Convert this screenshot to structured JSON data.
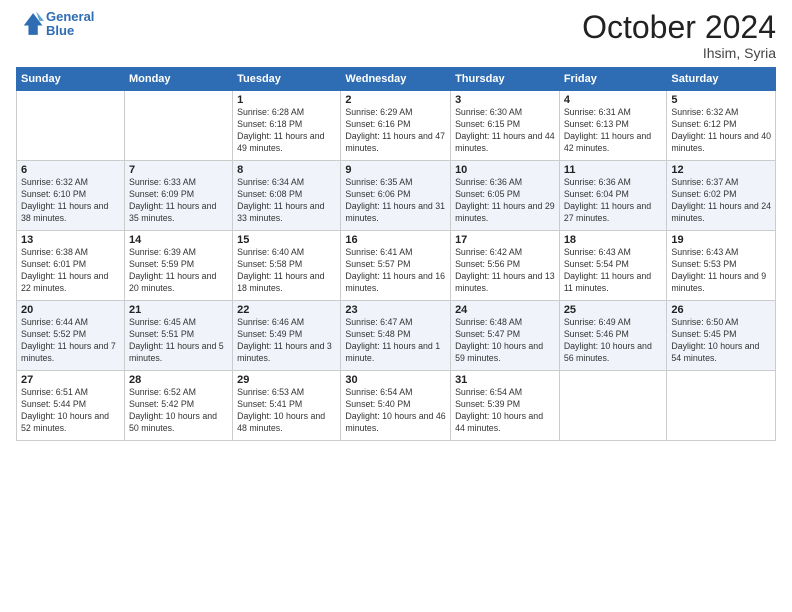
{
  "header": {
    "logo_line1": "General",
    "logo_line2": "Blue",
    "month": "October 2024",
    "location": "Ihsim, Syria"
  },
  "days_of_week": [
    "Sunday",
    "Monday",
    "Tuesday",
    "Wednesday",
    "Thursday",
    "Friday",
    "Saturday"
  ],
  "weeks": [
    [
      {
        "day": "",
        "info": ""
      },
      {
        "day": "",
        "info": ""
      },
      {
        "day": "1",
        "info": "Sunrise: 6:28 AM\nSunset: 6:18 PM\nDaylight: 11 hours and 49 minutes."
      },
      {
        "day": "2",
        "info": "Sunrise: 6:29 AM\nSunset: 6:16 PM\nDaylight: 11 hours and 47 minutes."
      },
      {
        "day": "3",
        "info": "Sunrise: 6:30 AM\nSunset: 6:15 PM\nDaylight: 11 hours and 44 minutes."
      },
      {
        "day": "4",
        "info": "Sunrise: 6:31 AM\nSunset: 6:13 PM\nDaylight: 11 hours and 42 minutes."
      },
      {
        "day": "5",
        "info": "Sunrise: 6:32 AM\nSunset: 6:12 PM\nDaylight: 11 hours and 40 minutes."
      }
    ],
    [
      {
        "day": "6",
        "info": "Sunrise: 6:32 AM\nSunset: 6:10 PM\nDaylight: 11 hours and 38 minutes."
      },
      {
        "day": "7",
        "info": "Sunrise: 6:33 AM\nSunset: 6:09 PM\nDaylight: 11 hours and 35 minutes."
      },
      {
        "day": "8",
        "info": "Sunrise: 6:34 AM\nSunset: 6:08 PM\nDaylight: 11 hours and 33 minutes."
      },
      {
        "day": "9",
        "info": "Sunrise: 6:35 AM\nSunset: 6:06 PM\nDaylight: 11 hours and 31 minutes."
      },
      {
        "day": "10",
        "info": "Sunrise: 6:36 AM\nSunset: 6:05 PM\nDaylight: 11 hours and 29 minutes."
      },
      {
        "day": "11",
        "info": "Sunrise: 6:36 AM\nSunset: 6:04 PM\nDaylight: 11 hours and 27 minutes."
      },
      {
        "day": "12",
        "info": "Sunrise: 6:37 AM\nSunset: 6:02 PM\nDaylight: 11 hours and 24 minutes."
      }
    ],
    [
      {
        "day": "13",
        "info": "Sunrise: 6:38 AM\nSunset: 6:01 PM\nDaylight: 11 hours and 22 minutes."
      },
      {
        "day": "14",
        "info": "Sunrise: 6:39 AM\nSunset: 5:59 PM\nDaylight: 11 hours and 20 minutes."
      },
      {
        "day": "15",
        "info": "Sunrise: 6:40 AM\nSunset: 5:58 PM\nDaylight: 11 hours and 18 minutes."
      },
      {
        "day": "16",
        "info": "Sunrise: 6:41 AM\nSunset: 5:57 PM\nDaylight: 11 hours and 16 minutes."
      },
      {
        "day": "17",
        "info": "Sunrise: 6:42 AM\nSunset: 5:56 PM\nDaylight: 11 hours and 13 minutes."
      },
      {
        "day": "18",
        "info": "Sunrise: 6:43 AM\nSunset: 5:54 PM\nDaylight: 11 hours and 11 minutes."
      },
      {
        "day": "19",
        "info": "Sunrise: 6:43 AM\nSunset: 5:53 PM\nDaylight: 11 hours and 9 minutes."
      }
    ],
    [
      {
        "day": "20",
        "info": "Sunrise: 6:44 AM\nSunset: 5:52 PM\nDaylight: 11 hours and 7 minutes."
      },
      {
        "day": "21",
        "info": "Sunrise: 6:45 AM\nSunset: 5:51 PM\nDaylight: 11 hours and 5 minutes."
      },
      {
        "day": "22",
        "info": "Sunrise: 6:46 AM\nSunset: 5:49 PM\nDaylight: 11 hours and 3 minutes."
      },
      {
        "day": "23",
        "info": "Sunrise: 6:47 AM\nSunset: 5:48 PM\nDaylight: 11 hours and 1 minute."
      },
      {
        "day": "24",
        "info": "Sunrise: 6:48 AM\nSunset: 5:47 PM\nDaylight: 10 hours and 59 minutes."
      },
      {
        "day": "25",
        "info": "Sunrise: 6:49 AM\nSunset: 5:46 PM\nDaylight: 10 hours and 56 minutes."
      },
      {
        "day": "26",
        "info": "Sunrise: 6:50 AM\nSunset: 5:45 PM\nDaylight: 10 hours and 54 minutes."
      }
    ],
    [
      {
        "day": "27",
        "info": "Sunrise: 6:51 AM\nSunset: 5:44 PM\nDaylight: 10 hours and 52 minutes."
      },
      {
        "day": "28",
        "info": "Sunrise: 6:52 AM\nSunset: 5:42 PM\nDaylight: 10 hours and 50 minutes."
      },
      {
        "day": "29",
        "info": "Sunrise: 6:53 AM\nSunset: 5:41 PM\nDaylight: 10 hours and 48 minutes."
      },
      {
        "day": "30",
        "info": "Sunrise: 6:54 AM\nSunset: 5:40 PM\nDaylight: 10 hours and 46 minutes."
      },
      {
        "day": "31",
        "info": "Sunrise: 6:54 AM\nSunset: 5:39 PM\nDaylight: 10 hours and 44 minutes."
      },
      {
        "day": "",
        "info": ""
      },
      {
        "day": "",
        "info": ""
      }
    ]
  ]
}
